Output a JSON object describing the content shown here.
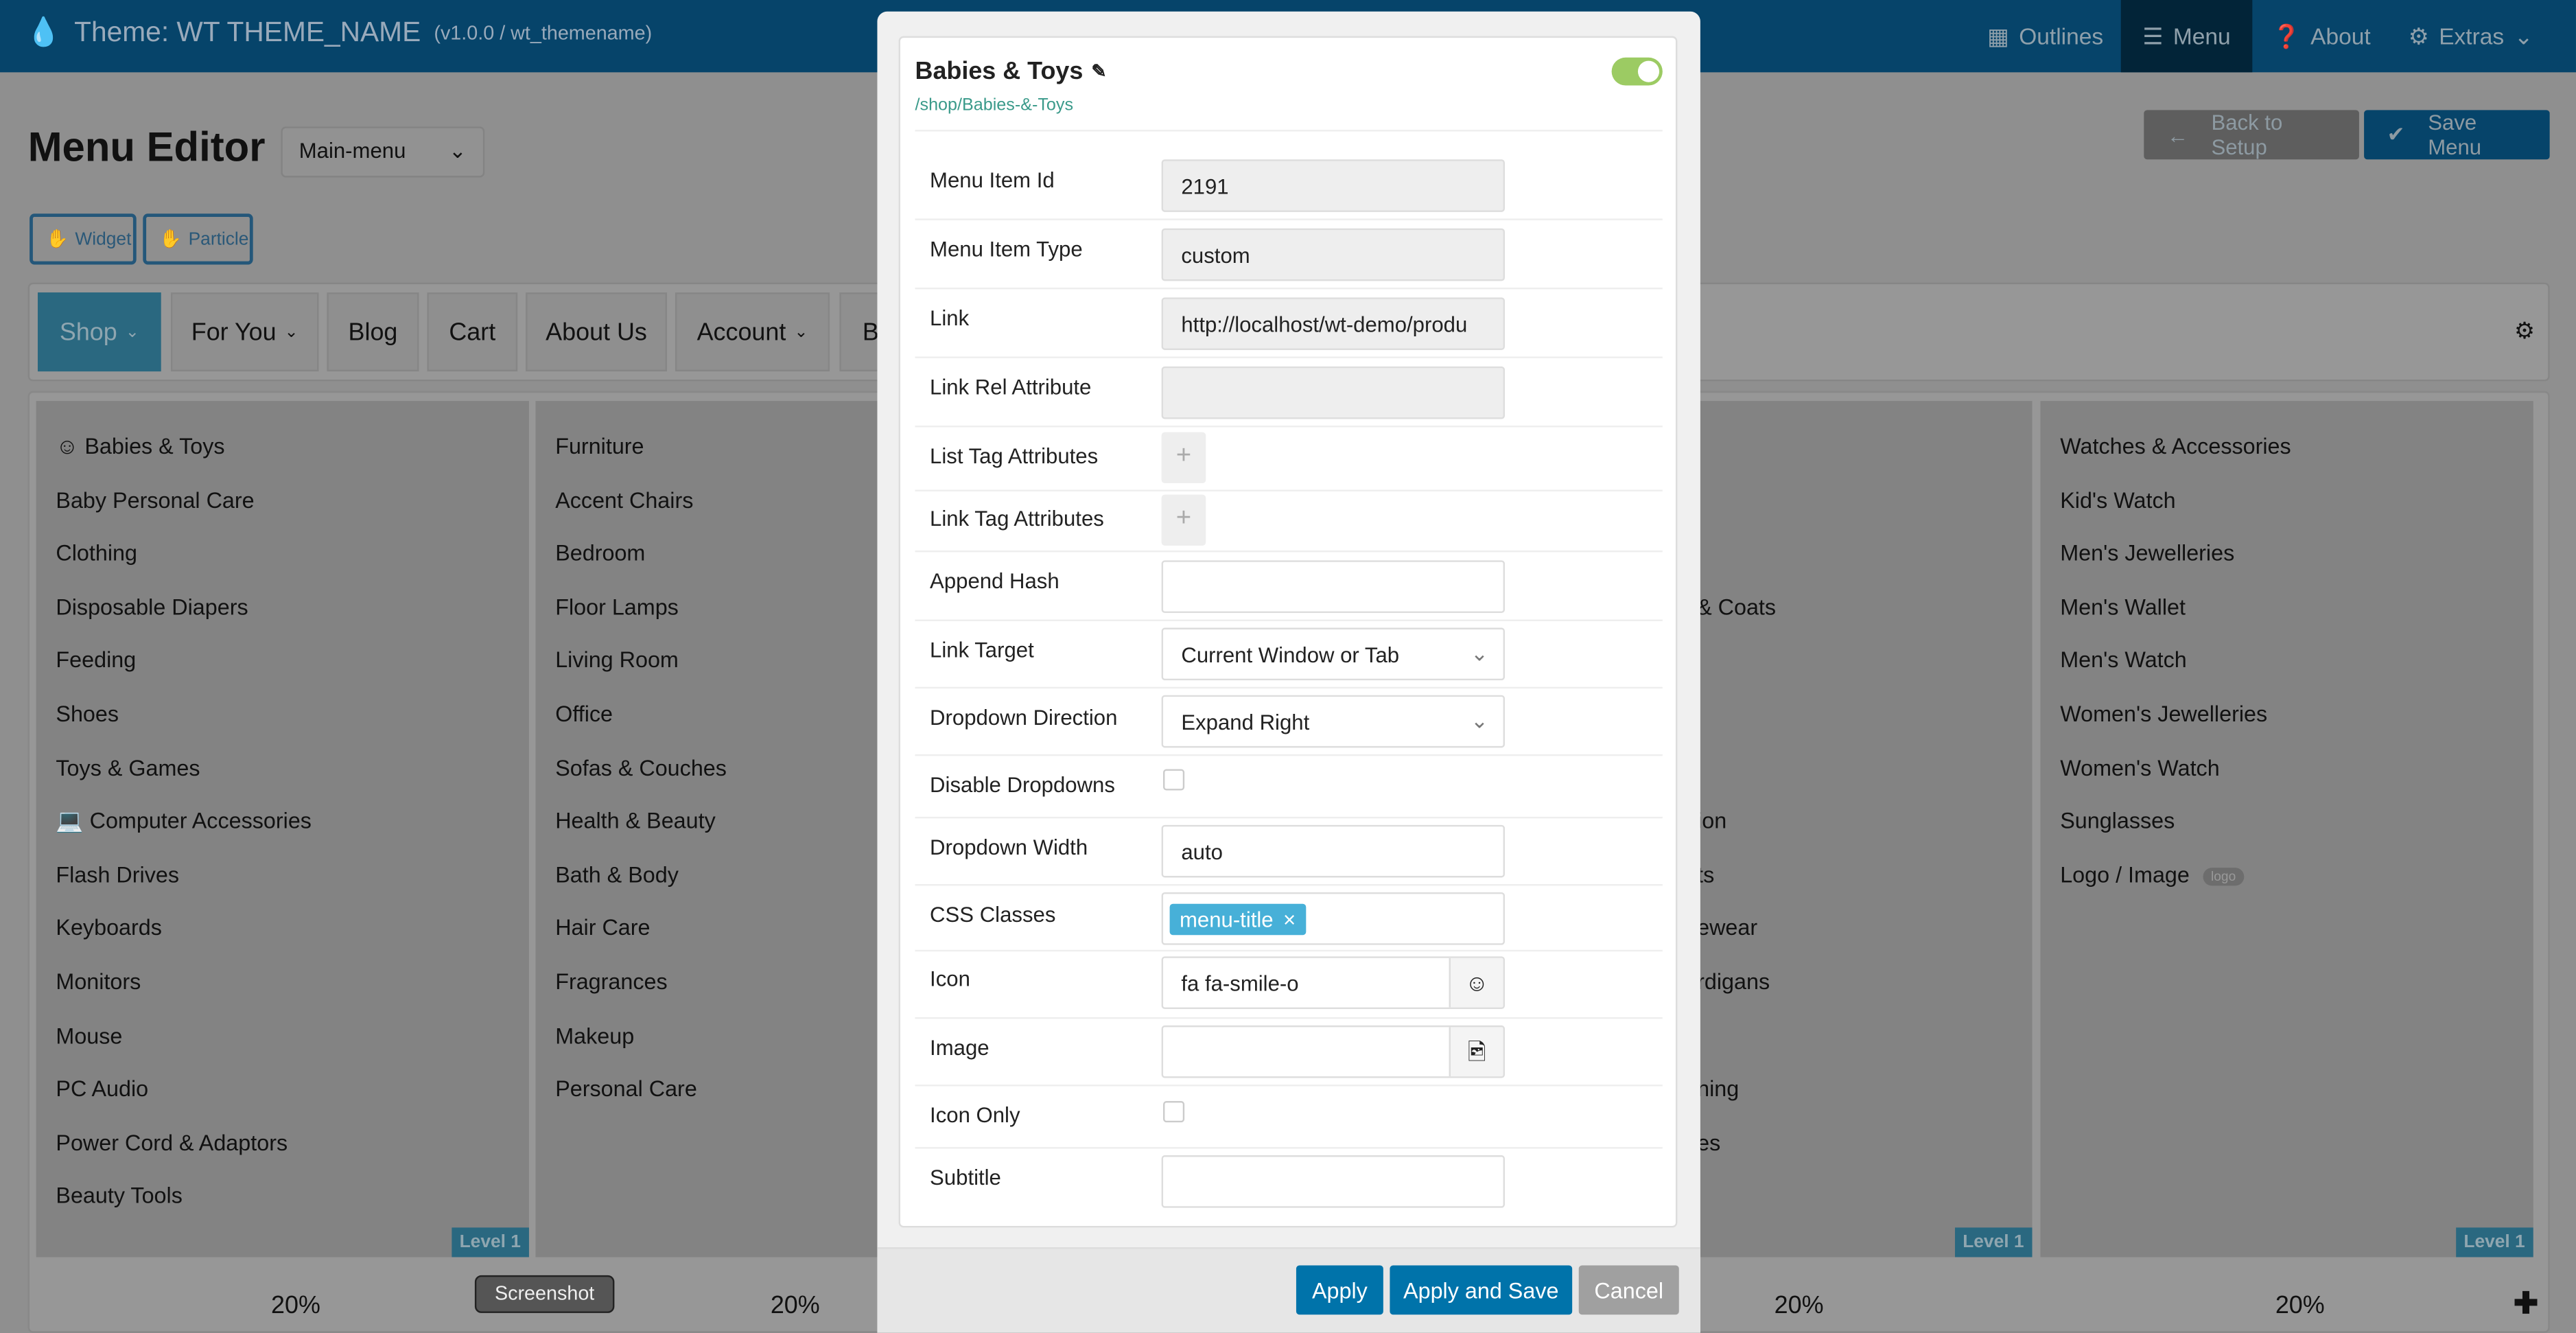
{
  "header": {
    "theme_title": "Theme: WT THEME_NAME",
    "theme_meta": "(v1.0.0 / wt_themename)",
    "nav": [
      {
        "label": "Outlines",
        "icon": "grid-icon"
      },
      {
        "label": "Menu",
        "icon": "bars-icon",
        "active": true
      },
      {
        "label": "About",
        "icon": "question-circle-icon"
      },
      {
        "label": "Extras",
        "icon": "gear-icon"
      }
    ]
  },
  "page": {
    "title": "Menu Editor",
    "menu_select": "Main-menu",
    "widget_label": "Widget",
    "particle_label": "Particle",
    "back_label": "Back to Setup",
    "save_label": "Save Menu"
  },
  "menu_bar": [
    "Shop",
    "For You",
    "Blog",
    "Cart",
    "About Us",
    "Account",
    "B"
  ],
  "columns": [
    {
      "items": [
        "☺ Babies & Toys",
        "Baby Personal Care",
        "Clothing",
        "Disposable Diapers",
        "Feeding",
        "Shoes",
        "Toys & Games",
        "💻 Computer Accessories",
        "Flash Drives",
        "Keyboards",
        "Monitors",
        "Mouse",
        "PC Audio",
        "Power Cord & Adaptors",
        "Beauty Tools"
      ],
      "level": "Level 1",
      "width": "20%"
    },
    {
      "items": [
        "Furniture",
        "Accent Chairs",
        "Bedroom",
        "Floor Lamps",
        "Living Room",
        "Office",
        "Sofas & Couches",
        "Health & Beauty",
        "Bath & Body",
        "Hair Care",
        "Fragrances",
        "Makeup",
        "Personal Care"
      ],
      "width": "20%"
    },
    {
      "items": [],
      "width": "20%"
    },
    {
      "items": [
        "",
        "",
        "",
        "& Coats",
        "",
        "",
        "",
        "ion",
        "ts",
        "ewear",
        "rdigans",
        "",
        "ning",
        "es"
      ],
      "level": "Level 1",
      "width": "20%"
    },
    {
      "items": [
        "Watches & Accessories",
        "Kid's Watch",
        "Men's Jewelleries",
        "Men's Wallet",
        "Men's Watch",
        "Women's Jewelleries",
        "Women's Watch",
        "Sunglasses",
        "Logo / Image"
      ],
      "badge": "logo",
      "level": "Level 1",
      "width": "20%"
    }
  ],
  "tooltip": "Screenshot",
  "modal": {
    "title": "Babies & Toys",
    "path": "/shop/Babies-&-Toys",
    "enabled": true,
    "fields": {
      "id_label": "Menu Item Id",
      "id": "2191",
      "type_label": "Menu Item Type",
      "type": "custom",
      "link_label": "Link",
      "link": "http://localhost/wt-demo/produ",
      "rel_label": "Link Rel Attribute",
      "rel": "",
      "list_attr_label": "List Tag Attributes",
      "link_attr_label": "Link Tag Attributes",
      "hash_label": "Append Hash",
      "hash": "",
      "target_label": "Link Target",
      "target": "Current Window or Tab",
      "dir_label": "Dropdown Direction",
      "dir": "Expand Right",
      "disable_label": "Disable Dropdowns",
      "width_label": "Dropdown Width",
      "width": "auto",
      "css_label": "CSS Classes",
      "css_tag": "menu-title",
      "icon_label": "Icon",
      "icon": "fa fa-smile-o",
      "image_label": "Image",
      "image": "",
      "icononly_label": "Icon Only",
      "subtitle_label": "Subtitle",
      "subtitle": ""
    },
    "apply": "Apply",
    "apply_save": "Apply and Save",
    "cancel": "Cancel"
  },
  "colors": {
    "header": "#06446a",
    "accent": "#0073aa",
    "toggle": "#9ccb63",
    "tag": "#47b0d8"
  }
}
